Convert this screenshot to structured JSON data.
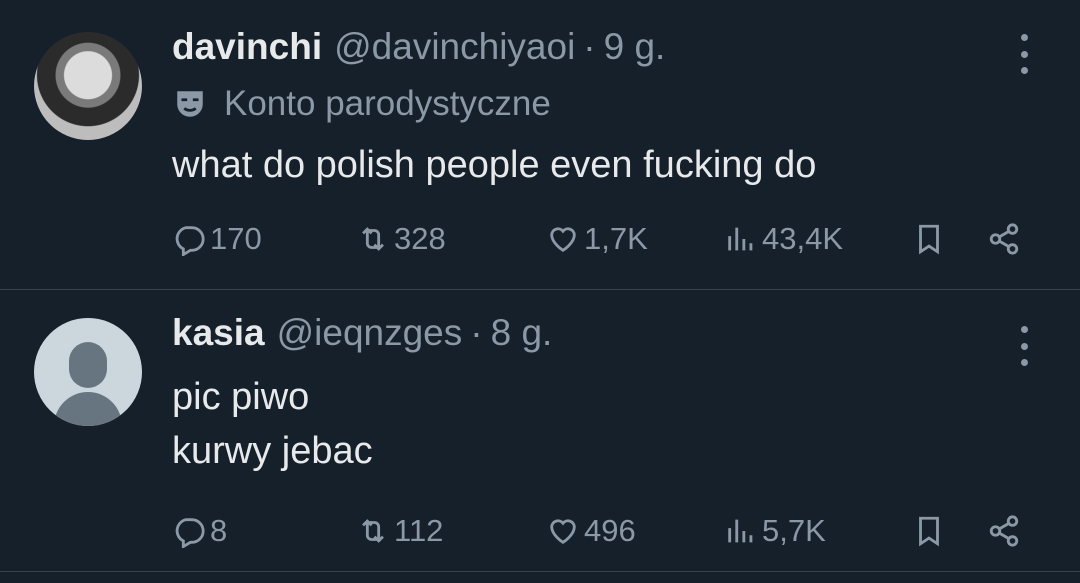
{
  "tweets": [
    {
      "name": "davinchi",
      "handle": "@davinchiyaoi",
      "separator": "·",
      "time": "9 g.",
      "parody_label": "Konto parodystyczne",
      "text_lines": [
        "what do polish people even fucking do"
      ],
      "replies": "170",
      "retweets": "328",
      "likes": "1,7K",
      "views": "43,4K"
    },
    {
      "name": "kasia",
      "handle": "@ieqnzges",
      "separator": "·",
      "time": "8 g.",
      "text_lines": [
        "pic piwo",
        "kurwy jebac"
      ],
      "replies": "8",
      "retweets": "112",
      "likes": "496",
      "views": "5,7K"
    }
  ],
  "icons": {
    "reply": "reply-icon",
    "retweet": "retweet-icon",
    "like": "heart-icon",
    "views": "views-icon",
    "bookmark": "bookmark-icon",
    "share": "share-icon",
    "more": "more-icon",
    "parody": "mask-icon"
  },
  "colors": {
    "background": "#15202b",
    "primary_text": "#e7e9ea",
    "secondary_text": "#8b98a5",
    "divider": "#38444d"
  }
}
